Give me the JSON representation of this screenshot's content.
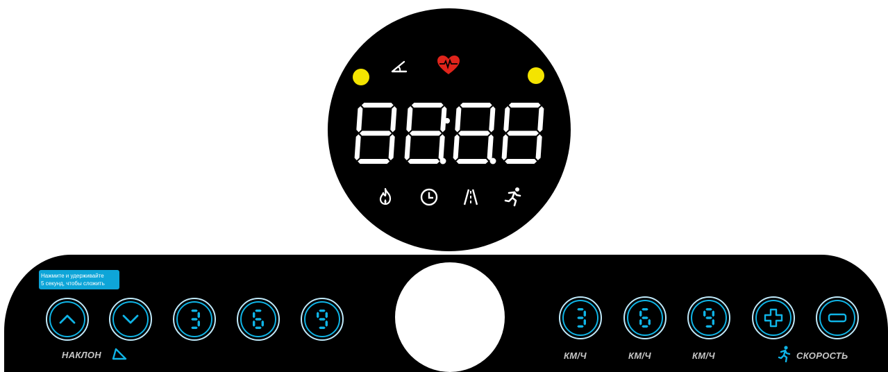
{
  "display": {
    "digits": [
      "8",
      "8",
      "8",
      "8"
    ],
    "indicators": [
      "incline-icon",
      "heart-rate-icon",
      "calories-icon",
      "time-icon",
      "distance-icon",
      "speed-icon"
    ],
    "colors": {
      "segment": "#ffffff",
      "heart": "#e0241b",
      "indicator_dot": "#f4e400"
    }
  },
  "panel": {
    "hint": {
      "line1": "Нажмите и удерживайте",
      "line2": "5 секунд, чтобы сложить"
    },
    "incline": {
      "up_icon": "chevron-up-icon",
      "down_icon": "chevron-down-icon",
      "presets": [
        "3",
        "6",
        "9"
      ],
      "label": "НАКЛОН"
    },
    "speed": {
      "presets": [
        "3",
        "6",
        "9"
      ],
      "preset_unit": "КМ/Ч",
      "plus_icon": "plus-icon",
      "minus_icon": "minus-icon",
      "label": "СКОРОСТЬ"
    },
    "colors": {
      "accent": "#0fb4e6",
      "ring": "#bfe9fa",
      "panel": "#000000",
      "label": "#c7c7c7",
      "hint_bg": "#0ea5d8"
    }
  }
}
